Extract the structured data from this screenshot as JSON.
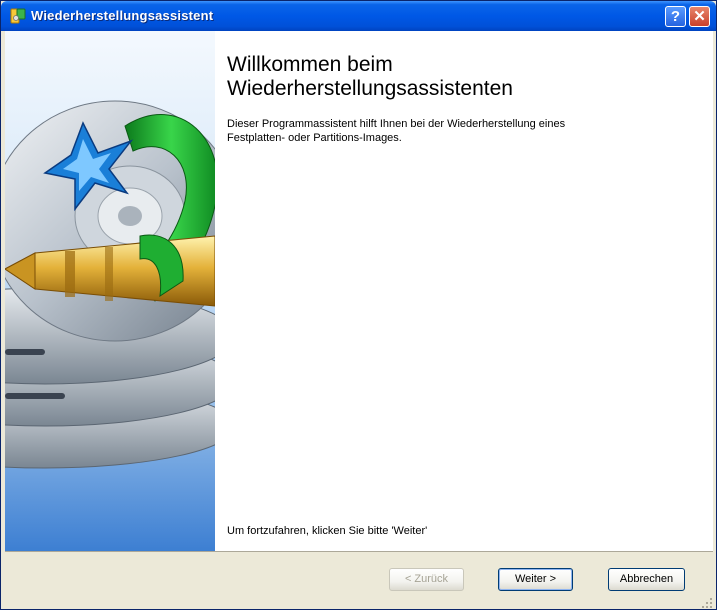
{
  "window": {
    "title": "Wiederherstellungsassistent",
    "help_label": "?",
    "close_label": "✕"
  },
  "icons": {
    "app": "restore-wizard-app-icon",
    "help": "help-icon",
    "close": "close-icon",
    "banner": "disk-image-banner-illustration"
  },
  "main": {
    "title_line1": "Willkommen beim",
    "title_line2": "Wiederherstellungsassistenten",
    "description_line1": "Dieser Programmassistent hilft Ihnen bei der Wiederherstellung eines",
    "description_line2": "Festplatten- oder Partitions-Images.",
    "continue_hint": "Um fortzufahren, klicken Sie bitte 'Weiter'"
  },
  "buttons": {
    "back": "< Zurück",
    "next": "Weiter >",
    "cancel": "Abbrechen"
  },
  "colors": {
    "titlebar": "#0058e6",
    "window_face": "#ece9d8",
    "content_bg": "#ffffff",
    "close_red": "#c9402a"
  }
}
